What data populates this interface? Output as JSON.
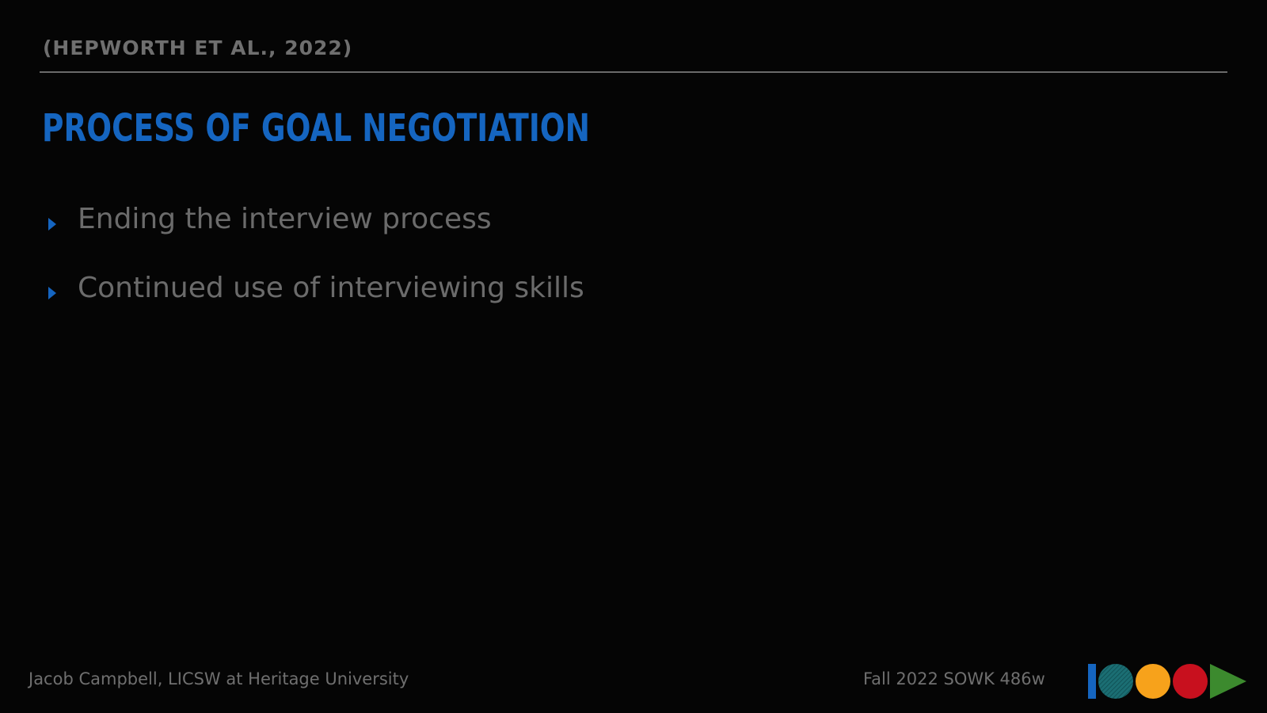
{
  "header": {
    "citation": "(HEPWORTH ET AL., 2022)"
  },
  "slide": {
    "title": "PROCESS OF GOAL NEGOTIATION",
    "bullets": [
      "Ending the interview process",
      "Continued use of interviewing skills"
    ]
  },
  "footer": {
    "presenter": "Jacob Campbell, LICSW at Heritage University",
    "course": "Fall 2022 SOWK 486w"
  },
  "colors": {
    "background": "#050505",
    "accent_blue": "#1565c0",
    "text_gray": "#6b6b6b",
    "logo_teal": "#1b6e73",
    "logo_orange": "#f7a21b",
    "logo_red": "#c8101e",
    "logo_green": "#3c8a2e"
  },
  "icons": {
    "bullet": "triangle-right-icon",
    "logo": "course-logo-shapes-icon"
  }
}
